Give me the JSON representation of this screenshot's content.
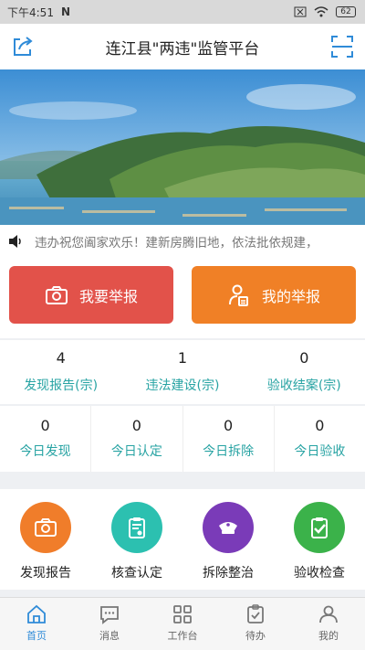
{
  "status_bar": {
    "time": "下午4:51",
    "carrier_icon": "n-logo",
    "battery": "62"
  },
  "header": {
    "title": "连江县\"两违\"监管平台",
    "left_icon": "share-icon",
    "right_icon": "scan-icon"
  },
  "banner": {
    "image": "coastal-landscape"
  },
  "notice": {
    "text": "违办祝您阖家欢乐！建新房腾旧地，依法批依规建，"
  },
  "actions": {
    "report_label": "我要举报",
    "my_report_label": "我的举报"
  },
  "stats": [
    {
      "value": "4",
      "label": "发现报告(宗)"
    },
    {
      "value": "1",
      "label": "违法建设(宗)"
    },
    {
      "value": "0",
      "label": "验收结案(宗)"
    }
  ],
  "today": [
    {
      "value": "0",
      "label": "今日发现"
    },
    {
      "value": "0",
      "label": "今日认定"
    },
    {
      "value": "0",
      "label": "今日拆除"
    },
    {
      "value": "0",
      "label": "今日验收"
    }
  ],
  "quick": [
    {
      "label": "发现报告",
      "color": "#f07d2a",
      "icon": "camera-icon"
    },
    {
      "label": "核查认定",
      "color": "#2cc0b0",
      "icon": "clipboard-icon"
    },
    {
      "label": "拆除整治",
      "color": "#7a3bb8",
      "icon": "police-cap-icon"
    },
    {
      "label": "验收检查",
      "color": "#3bb24a",
      "icon": "check-clipboard-icon"
    }
  ],
  "tabs": [
    {
      "label": "首页",
      "active": true
    },
    {
      "label": "消息"
    },
    {
      "label": "工作台"
    },
    {
      "label": "待办"
    },
    {
      "label": "我的"
    }
  ],
  "colors": {
    "accent": "#2f8bd8",
    "report": "#e2524a",
    "mine": "#f08026",
    "stat_label": "#27a3a3"
  }
}
